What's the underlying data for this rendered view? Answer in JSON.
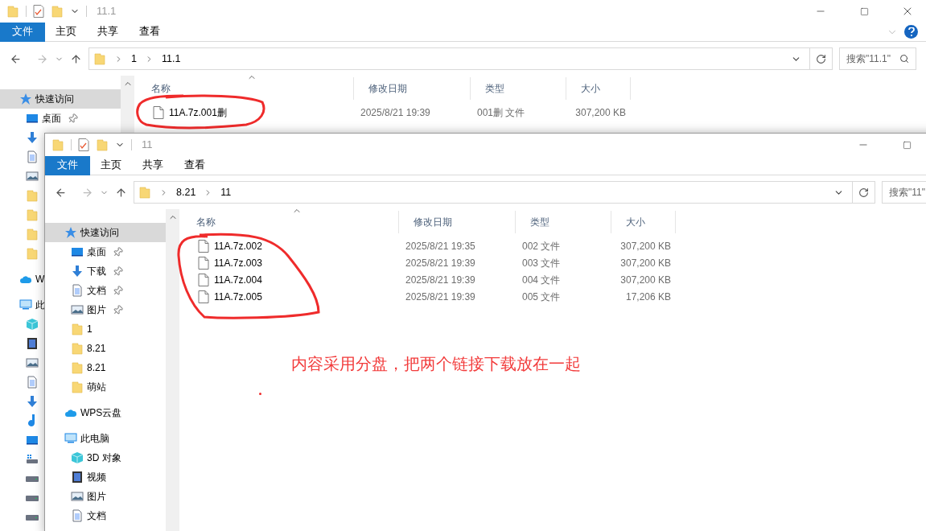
{
  "windows": [
    {
      "title": "11.1",
      "ribbon": [
        {
          "label": "文件",
          "kind": "file-menu"
        },
        {
          "label": "主页",
          "kind": "tab"
        },
        {
          "label": "共享",
          "kind": "tab"
        },
        {
          "label": "查看",
          "kind": "tab"
        }
      ],
      "path": [
        "1",
        "11.1"
      ],
      "search": {
        "placeholder": "搜索\"11.1\""
      },
      "sidebar": [
        {
          "kind": "star",
          "label": "快速访问",
          "selected": true,
          "children": [
            {
              "kind": "desktop",
              "label": "桌面",
              "selected": false,
              "pinned": true
            },
            {
              "kind": "download",
              "selected": false
            },
            {
              "kind": "document",
              "selected": false
            },
            {
              "kind": "picture",
              "selected": false
            },
            {
              "kind": "folder",
              "selected": false
            },
            {
              "kind": "folder",
              "selected": false
            },
            {
              "kind": "folder",
              "selected": false
            },
            {
              "kind": "folder",
              "selected": false
            }
          ]
        },
        {
          "kind": "cloud",
          "label": "W",
          "selected": false
        },
        {
          "kind": "pc",
          "label": "此",
          "selected": false,
          "children": [
            {
              "kind": "cube",
              "selected": false
            },
            {
              "kind": "video",
              "selected": false
            },
            {
              "kind": "picture",
              "selected": false
            },
            {
              "kind": "document",
              "selected": false
            },
            {
              "kind": "download",
              "selected": false
            },
            {
              "kind": "music",
              "selected": false
            },
            {
              "kind": "desktop",
              "selected": false
            },
            {
              "kind": "system-drive",
              "selected": false
            },
            {
              "kind": "drive",
              "selected": false
            },
            {
              "kind": "drive",
              "selected": false
            },
            {
              "kind": "drive",
              "selected": false
            }
          ]
        }
      ],
      "columns": [
        "名称",
        "修改日期",
        "类型",
        "大小"
      ],
      "rows": [
        {
          "name": "11A.7z.001删",
          "modified": "2025/8/21 19:39",
          "type": "001删 文件",
          "size": "307,200 KB"
        }
      ]
    },
    {
      "title": "11",
      "ribbon": [
        {
          "label": "文件",
          "kind": "file-menu"
        },
        {
          "label": "主页",
          "kind": "tab"
        },
        {
          "label": "共享",
          "kind": "tab"
        },
        {
          "label": "查看",
          "kind": "tab"
        }
      ],
      "path": [
        "8.21",
        "11"
      ],
      "search": {
        "placeholder": "搜索\"11\""
      },
      "sidebar": [
        {
          "kind": "star",
          "label": "快速访问",
          "selected": true,
          "children": [
            {
              "kind": "desktop",
              "label": "桌面",
              "selected": false,
              "pinned": true
            },
            {
              "kind": "download",
              "label": "下载",
              "selected": false,
              "pinned": true
            },
            {
              "kind": "document",
              "label": "文档",
              "selected": false,
              "pinned": true
            },
            {
              "kind": "picture",
              "label": "图片",
              "selected": false,
              "pinned": true
            },
            {
              "kind": "folder",
              "label": "1",
              "selected": false,
              "pinned": false
            },
            {
              "kind": "folder",
              "label": "8.21",
              "selected": false,
              "pinned": false
            },
            {
              "kind": "folder",
              "label": "8.21",
              "selected": false,
              "pinned": false
            },
            {
              "kind": "folder",
              "label": "萌站",
              "selected": false,
              "pinned": false
            }
          ]
        },
        {
          "kind": "cloud",
          "label": "WPS云盘",
          "selected": false
        },
        {
          "kind": "pc",
          "label": "此电脑",
          "selected": false,
          "children": [
            {
              "kind": "cube",
              "label": "3D 对象",
              "selected": false
            },
            {
              "kind": "video",
              "label": "视频",
              "selected": false
            },
            {
              "kind": "picture",
              "label": "图片",
              "selected": false
            },
            {
              "kind": "document",
              "label": "文档",
              "selected": false
            }
          ]
        }
      ],
      "columns": [
        "名称",
        "修改日期",
        "类型",
        "大小"
      ],
      "rows": [
        {
          "name": "11A.7z.002",
          "modified": "2025/8/21 19:35",
          "type": "002 文件",
          "size": "307,200 KB"
        },
        {
          "name": "11A.7z.003",
          "modified": "2025/8/21 19:39",
          "type": "003 文件",
          "size": "307,200 KB"
        },
        {
          "name": "11A.7z.004",
          "modified": "2025/8/21 19:39",
          "type": "004 文件",
          "size": "307,200 KB"
        },
        {
          "name": "11A.7z.005",
          "modified": "2025/8/21 19:39",
          "type": "005 文件",
          "size": "17,206 KB"
        }
      ],
      "note": "内容采用分盘，把两个链接下载放在一起"
    }
  ]
}
